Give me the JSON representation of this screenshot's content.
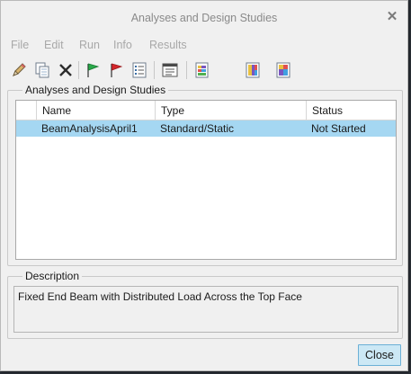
{
  "window": {
    "title": "Analyses and Design Studies",
    "close_glyph": "✕"
  },
  "menu": [
    {
      "label": "File"
    },
    {
      "label": "Edit"
    },
    {
      "label": "Run"
    },
    {
      "label": "Info"
    },
    {
      "label": "Results"
    }
  ],
  "toolbar": [
    {
      "icon": "pencil-icon"
    },
    {
      "icon": "copy-icon"
    },
    {
      "icon": "delete-icon"
    },
    {
      "icon": "green-flag-icon"
    },
    {
      "icon": "red-flag-icon"
    },
    {
      "icon": "list-icon"
    },
    {
      "icon": "display-study-status-icon"
    },
    {
      "icon": "results-icon-1"
    },
    {
      "icon": "results-icon-2"
    },
    {
      "icon": "results-icon-3"
    }
  ],
  "studies": {
    "group_label": "Analyses and Design Studies",
    "columns": [
      "Name",
      "Type",
      "Status"
    ],
    "rows": [
      {
        "name": "BeamAnalysisApril1",
        "type": "Standard/Static",
        "status": "Not Started"
      }
    ]
  },
  "description": {
    "group_label": "Description",
    "text": "Fixed End Beam with Distributed Load Across the Top Face"
  },
  "buttons": {
    "close_label": "Close"
  },
  "colors": {
    "selected_row": "#a5d7f2",
    "close_button_bg": "#cce8f5",
    "close_button_border": "#6bb0d6"
  }
}
